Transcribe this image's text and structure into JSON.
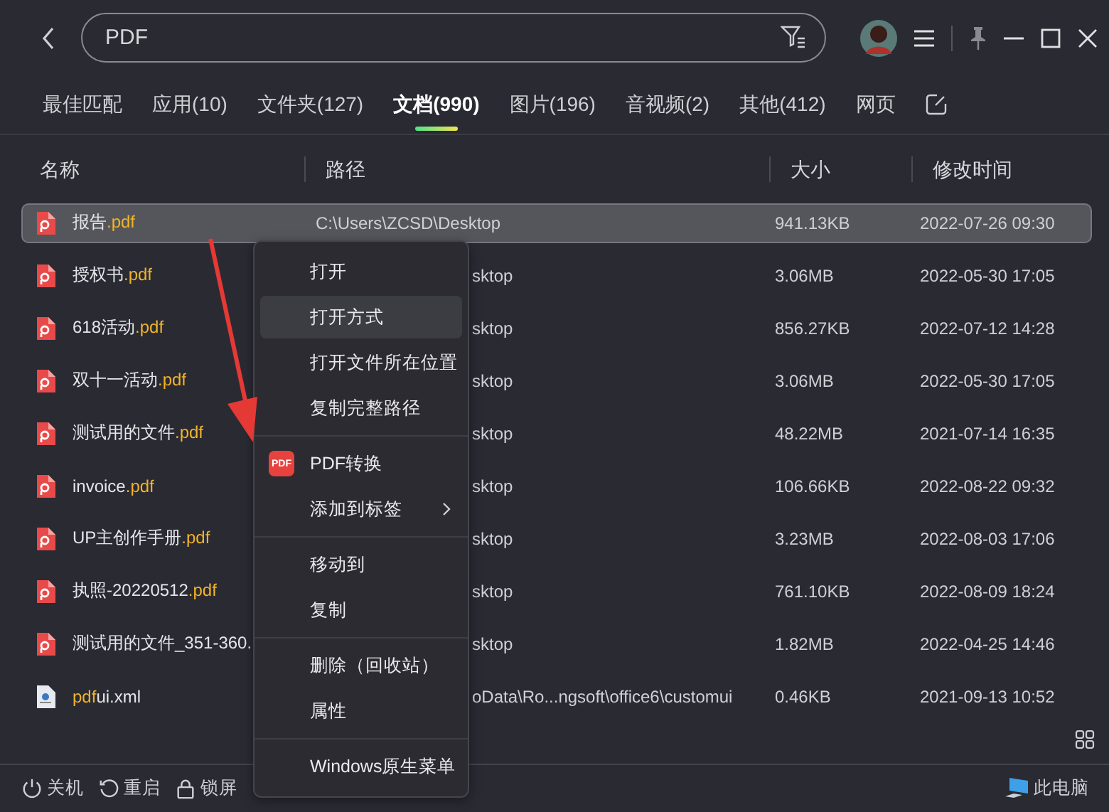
{
  "search": {
    "value": "PDF"
  },
  "tabs": [
    {
      "label": "最佳匹配",
      "selected": false
    },
    {
      "label": "应用(10)",
      "selected": false
    },
    {
      "label": "文件夹(127)",
      "selected": false
    },
    {
      "label": "文档(990)",
      "selected": true
    },
    {
      "label": "图片(196)",
      "selected": false
    },
    {
      "label": "音视频(2)",
      "selected": false
    },
    {
      "label": "其他(412)",
      "selected": false
    },
    {
      "label": "网页",
      "selected": false
    }
  ],
  "table": {
    "columns": [
      "名称",
      "路径",
      "大小",
      "修改时间"
    ],
    "rows": [
      {
        "kind": "pdf",
        "selected": true,
        "covered": false,
        "name": [
          {
            "text": "报告",
            "match": false
          },
          {
            "text": ".pdf",
            "match": true
          }
        ],
        "path": "C:\\Users\\ZCSD\\Desktop",
        "size": "941.13KB",
        "modified": "2022-07-26 09:30"
      },
      {
        "kind": "pdf",
        "selected": false,
        "covered": true,
        "name": [
          {
            "text": "授权书",
            "match": false
          },
          {
            "text": ".pdf",
            "match": true
          }
        ],
        "path": "sktop",
        "size": "3.06MB",
        "modified": "2022-05-30 17:05"
      },
      {
        "kind": "pdf",
        "selected": false,
        "covered": true,
        "name": [
          {
            "text": "618活动",
            "match": false
          },
          {
            "text": ".pdf",
            "match": true
          }
        ],
        "path": "sktop",
        "size": "856.27KB",
        "modified": "2022-07-12 14:28"
      },
      {
        "kind": "pdf",
        "selected": false,
        "covered": true,
        "name": [
          {
            "text": "双十一活动",
            "match": false
          },
          {
            "text": ".pdf",
            "match": true
          }
        ],
        "path": "sktop",
        "size": "3.06MB",
        "modified": "2022-05-30 17:05"
      },
      {
        "kind": "pdf",
        "selected": false,
        "covered": true,
        "name": [
          {
            "text": "测试用的文件",
            "match": false
          },
          {
            "text": ".pdf",
            "match": true
          }
        ],
        "path": "sktop",
        "size": "48.22MB",
        "modified": "2021-07-14 16:35"
      },
      {
        "kind": "pdf",
        "selected": false,
        "covered": true,
        "name": [
          {
            "text": "invoice",
            "match": false
          },
          {
            "text": ".pdf",
            "match": true
          }
        ],
        "path": "sktop",
        "size": "106.66KB",
        "modified": "2022-08-22 09:32"
      },
      {
        "kind": "pdf",
        "selected": false,
        "covered": true,
        "name": [
          {
            "text": "UP主创作手册",
            "match": false
          },
          {
            "text": ".pdf",
            "match": true
          }
        ],
        "path": "sktop",
        "size": "3.23MB",
        "modified": "2022-08-03 17:06"
      },
      {
        "kind": "pdf",
        "selected": false,
        "covered": true,
        "name": [
          {
            "text": "执照-20220512",
            "match": false
          },
          {
            "text": ".pdf",
            "match": true
          }
        ],
        "path": "sktop",
        "size": "761.10KB",
        "modified": "2022-08-09 18:24"
      },
      {
        "kind": "pdf",
        "selected": false,
        "covered": true,
        "name": [
          {
            "text": "测试用的文件_351-360.",
            "match": false
          }
        ],
        "path": "sktop",
        "size": "1.82MB",
        "modified": "2022-04-25 14:46"
      },
      {
        "kind": "xml",
        "selected": false,
        "covered": true,
        "name": [
          {
            "text": "pdf",
            "match": true
          },
          {
            "text": "ui.xml",
            "match": false
          }
        ],
        "path": "oData\\Ro...ngsoft\\office6\\customui",
        "size": "0.46KB",
        "modified": "2021-09-13 10:52"
      }
    ]
  },
  "context_menu": {
    "groups": [
      [
        {
          "label": "打开",
          "kind": "item",
          "highlighted": false
        },
        {
          "label": "打开方式",
          "kind": "item",
          "highlighted": true
        },
        {
          "label": "打开文件所在位置",
          "kind": "item",
          "highlighted": false
        },
        {
          "label": "复制完整路径",
          "kind": "item",
          "highlighted": false
        }
      ],
      [
        {
          "label": "PDF转换",
          "kind": "pdf",
          "highlighted": false,
          "badge": "PDF"
        },
        {
          "label": "添加到标签",
          "kind": "submenu",
          "highlighted": false
        }
      ],
      [
        {
          "label": "移动到",
          "kind": "item",
          "highlighted": false
        },
        {
          "label": "复制",
          "kind": "item",
          "highlighted": false
        }
      ],
      [
        {
          "label": "删除（回收站）",
          "kind": "item",
          "highlighted": false
        },
        {
          "label": "属性",
          "kind": "item",
          "highlighted": false
        }
      ],
      [
        {
          "label": "Windows原生菜单",
          "kind": "item",
          "highlighted": false
        }
      ]
    ]
  },
  "status_bar": {
    "actions": [
      {
        "label": "关机",
        "kind": "power"
      },
      {
        "label": "重启",
        "kind": "restart"
      },
      {
        "label": "锁屏",
        "kind": "lock"
      }
    ],
    "computer": "此电脑"
  }
}
